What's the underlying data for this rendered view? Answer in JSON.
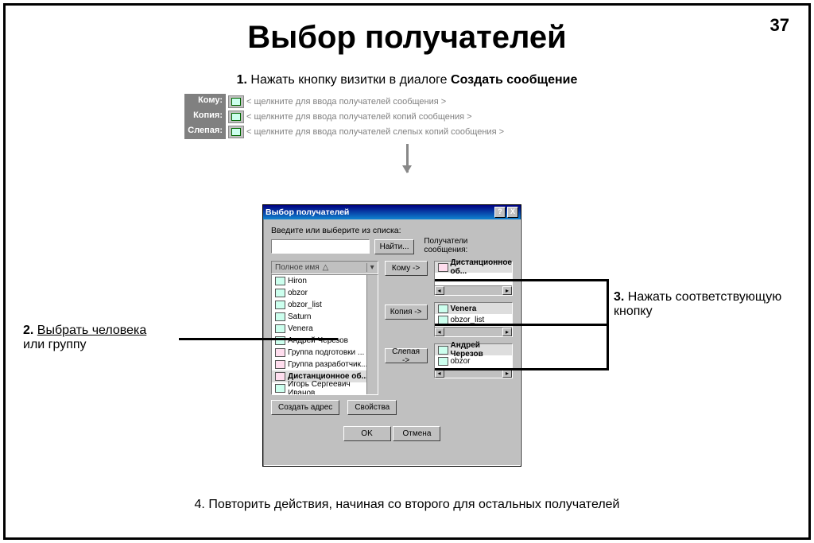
{
  "page_number": "37",
  "title": "Выбор получателей",
  "step1": {
    "num": "1.",
    "text": "Нажать кнопку визитки в диалоге ",
    "bold": "Создать сообщение"
  },
  "compose": {
    "rows": [
      {
        "label": "Кому:",
        "placeholder": "< щелкните для ввода получателей сообщения >"
      },
      {
        "label": "Копия:",
        "placeholder": "< щелкните для ввода получателей копий сообщения >"
      },
      {
        "label": "Слепая:",
        "placeholder": "< щелкните для ввода получателей слепых копий сообщения >"
      }
    ]
  },
  "dialog": {
    "title": "Выбор получателей",
    "enter_label": "Введите или выберите из списка:",
    "find_btn": "Найти...",
    "column_header": "Полное имя",
    "mid_buttons": [
      "Кому ->",
      "Копия ->",
      "Слепая ->"
    ],
    "recipients_label": "Получатели сообщения:",
    "list": [
      {
        "name": "Hiron",
        "grp": false
      },
      {
        "name": "obzor",
        "grp": false
      },
      {
        "name": "obzor_list",
        "grp": false
      },
      {
        "name": "Saturn",
        "grp": false
      },
      {
        "name": "Venera",
        "grp": false
      },
      {
        "name": "Андрей Черезов",
        "grp": false
      },
      {
        "name": "Группа подготовки ...",
        "grp": true
      },
      {
        "name": "Группа разработчик...",
        "grp": true
      },
      {
        "name": "Дистанционное об...",
        "grp": true,
        "sel": true
      },
      {
        "name": "Игорь Сергеевич Иванов",
        "grp": false
      }
    ],
    "box_to": [
      {
        "name": "Дистанционное об...",
        "grp": true,
        "sel": true
      }
    ],
    "box_cc": [
      {
        "name": "Venera",
        "grp": false,
        "sel": true
      },
      {
        "name": "obzor_list",
        "grp": false
      }
    ],
    "box_bcc": [
      {
        "name": "Андрей Черезов",
        "grp": false,
        "sel": true
      },
      {
        "name": "obzor",
        "grp": false
      }
    ],
    "create_addr": "Создать адрес",
    "properties": "Свойства",
    "ok": "OK",
    "cancel": "Отмена"
  },
  "step2": {
    "num": "2.",
    "underline": "Выбрать человека",
    "rest": "или группу"
  },
  "step3": {
    "num": "3.",
    "text": "Нажать соответствующую кнопку"
  },
  "step4": {
    "num": "4.",
    "text": "Повторить действия, начиная со второго для остальных получателей"
  }
}
